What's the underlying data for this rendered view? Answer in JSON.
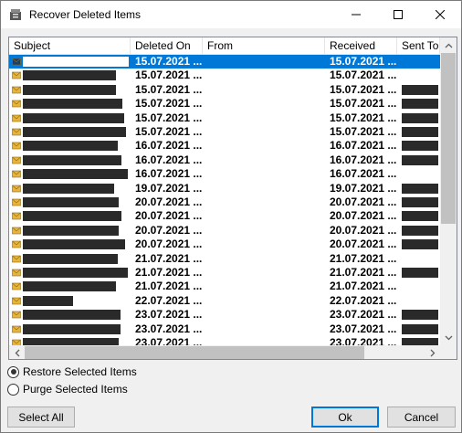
{
  "window": {
    "title": "Recover Deleted Items"
  },
  "columns": [
    "Subject",
    "Deleted On",
    "From",
    "Received",
    "Sent To"
  ],
  "rows": [
    {
      "deleted": "15.07.2021 ...",
      "received": "15.07.2021 ...",
      "selected": true,
      "subject_redacted": true,
      "sentto_redacted": false,
      "icon": "dark"
    },
    {
      "deleted": "15.07.2021 ...",
      "received": "15.07.2021 ...",
      "selected": false,
      "subject_redacted": true,
      "sentto_redacted": false,
      "icon": "envelope"
    },
    {
      "deleted": "15.07.2021 ...",
      "received": "15.07.2021 ...",
      "selected": false,
      "subject_redacted": true,
      "sentto_redacted": true,
      "icon": "envelope"
    },
    {
      "deleted": "15.07.2021 ...",
      "received": "15.07.2021 ...",
      "selected": false,
      "subject_redacted": true,
      "sentto_redacted": true,
      "icon": "envelope"
    },
    {
      "deleted": "15.07.2021 ...",
      "received": "15.07.2021 ...",
      "selected": false,
      "subject_redacted": true,
      "sentto_redacted": true,
      "icon": "envelope"
    },
    {
      "deleted": "15.07.2021 ...",
      "received": "15.07.2021 ...",
      "selected": false,
      "subject_redacted": true,
      "sentto_redacted": true,
      "icon": "envelope"
    },
    {
      "deleted": "16.07.2021 ...",
      "received": "16.07.2021 ...",
      "selected": false,
      "subject_redacted": true,
      "sentto_redacted": true,
      "icon": "envelope"
    },
    {
      "deleted": "16.07.2021 ...",
      "received": "16.07.2021 ...",
      "selected": false,
      "subject_redacted": true,
      "sentto_redacted": true,
      "icon": "envelope"
    },
    {
      "deleted": "16.07.2021 ...",
      "received": "16.07.2021 ...",
      "selected": false,
      "subject_redacted": true,
      "sentto_redacted": false,
      "icon": "envelope"
    },
    {
      "deleted": "19.07.2021 ...",
      "received": "19.07.2021 ...",
      "selected": false,
      "subject_redacted": true,
      "sentto_redacted": true,
      "icon": "envelope"
    },
    {
      "deleted": "20.07.2021 ...",
      "received": "20.07.2021 ...",
      "selected": false,
      "subject_redacted": true,
      "sentto_redacted": true,
      "icon": "envelope"
    },
    {
      "deleted": "20.07.2021 ...",
      "received": "20.07.2021 ...",
      "selected": false,
      "subject_redacted": true,
      "sentto_redacted": true,
      "icon": "envelope"
    },
    {
      "deleted": "20.07.2021 ...",
      "received": "20.07.2021 ...",
      "selected": false,
      "subject_redacted": true,
      "sentto_redacted": true,
      "icon": "envelope"
    },
    {
      "deleted": "20.07.2021 ...",
      "received": "20.07.2021 ...",
      "selected": false,
      "subject_redacted": true,
      "sentto_redacted": true,
      "icon": "envelope"
    },
    {
      "deleted": "21.07.2021 ...",
      "received": "21.07.2021 ...",
      "selected": false,
      "subject_redacted": true,
      "sentto_redacted": false,
      "icon": "envelope"
    },
    {
      "deleted": "21.07.2021 ...",
      "received": "21.07.2021 ...",
      "selected": false,
      "subject_redacted": true,
      "sentto_redacted": true,
      "icon": "envelope"
    },
    {
      "deleted": "21.07.2021 ...",
      "received": "21.07.2021 ...",
      "selected": false,
      "subject_redacted": true,
      "sentto_redacted": false,
      "icon": "envelope"
    },
    {
      "deleted": "22.07.2021 ...",
      "received": "22.07.2021 ...",
      "selected": false,
      "subject_redacted": true,
      "sentto_redacted": false,
      "icon": "envelope"
    },
    {
      "deleted": "23.07.2021 ...",
      "received": "23.07.2021 ...",
      "selected": false,
      "subject_redacted": true,
      "sentto_redacted": true,
      "icon": "envelope"
    },
    {
      "deleted": "23.07.2021 ...",
      "received": "23.07.2021 ...",
      "selected": false,
      "subject_redacted": true,
      "sentto_redacted": true,
      "icon": "envelope"
    },
    {
      "deleted": "23.07.2021 ...",
      "received": "23.07.2021 ...",
      "selected": false,
      "subject_redacted": true,
      "sentto_redacted": true,
      "icon": "envelope"
    }
  ],
  "options": {
    "restore_label": "Restore Selected Items",
    "purge_label": "Purge Selected Items",
    "selected": "restore"
  },
  "buttons": {
    "select_all": "Select All",
    "ok": "Ok",
    "cancel": "Cancel"
  },
  "colors": {
    "selection": "#0078d7",
    "envelope": "#e8b43a",
    "redaction": "#2a2a2a"
  }
}
